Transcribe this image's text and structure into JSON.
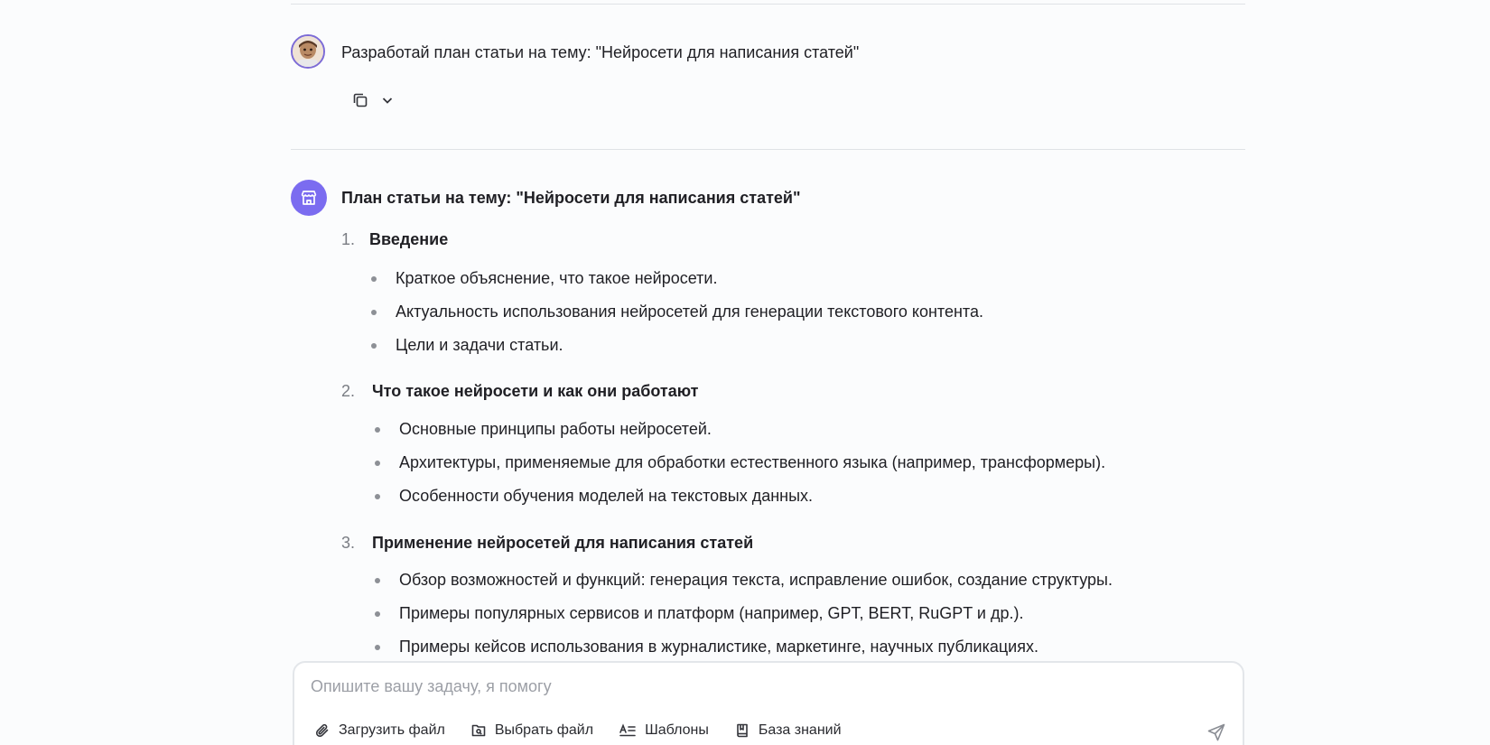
{
  "user_message": {
    "text": "Разработай план статьи на тему: \"Нейросети для написания статей\""
  },
  "answer": {
    "title": "План статьи на тему: \"Нейросети для написания статей\"",
    "sections": [
      {
        "num": "1.",
        "title": "Введение",
        "bullets": [
          "Краткое объяснение, что такое нейросети.",
          "Актуальность использования нейросетей для генерации текстового контента.",
          "Цели и задачи статьи."
        ]
      },
      {
        "num": "2.",
        "title": "Что такое нейросети и как они работают",
        "bullets": [
          "Основные принципы работы нейросетей.",
          "Архитектуры, применяемые для обработки естественного языка (например, трансформеры).",
          "Особенности обучения моделей на текстовых данных."
        ]
      },
      {
        "num": "3.",
        "title": "Применение нейросетей для написания статей",
        "bullets": [
          "Обзор возможностей и функций: генерация текста, исправление ошибок, создание структуры.",
          "Примеры популярных сервисов и платформ (например, GPT, BERT, RuGPT и др.).",
          "Примеры кейсов использования в журналистике, маркетинге, научных публикациях."
        ]
      }
    ]
  },
  "composer": {
    "placeholder": "Опишите вашу задачу, я помогу",
    "value": "",
    "tools": {
      "upload": "Загрузить файл",
      "choose": "Выбрать файл",
      "templates": "Шаблоны",
      "knowledge": "База знаний"
    }
  },
  "colors": {
    "accent": "#7b6cf0",
    "background": "#fbfcfd",
    "divider": "#dfe2e6",
    "text": "#1f1f24",
    "muted": "#9c9fa6"
  },
  "icons": {
    "copy": "copy-icon",
    "expand": "chevron-down-icon",
    "bot": "store-icon",
    "attach": "paperclip-icon",
    "file": "file-search-icon",
    "templates": "templates-icon",
    "knowledge": "book-icon",
    "send": "send-icon"
  }
}
